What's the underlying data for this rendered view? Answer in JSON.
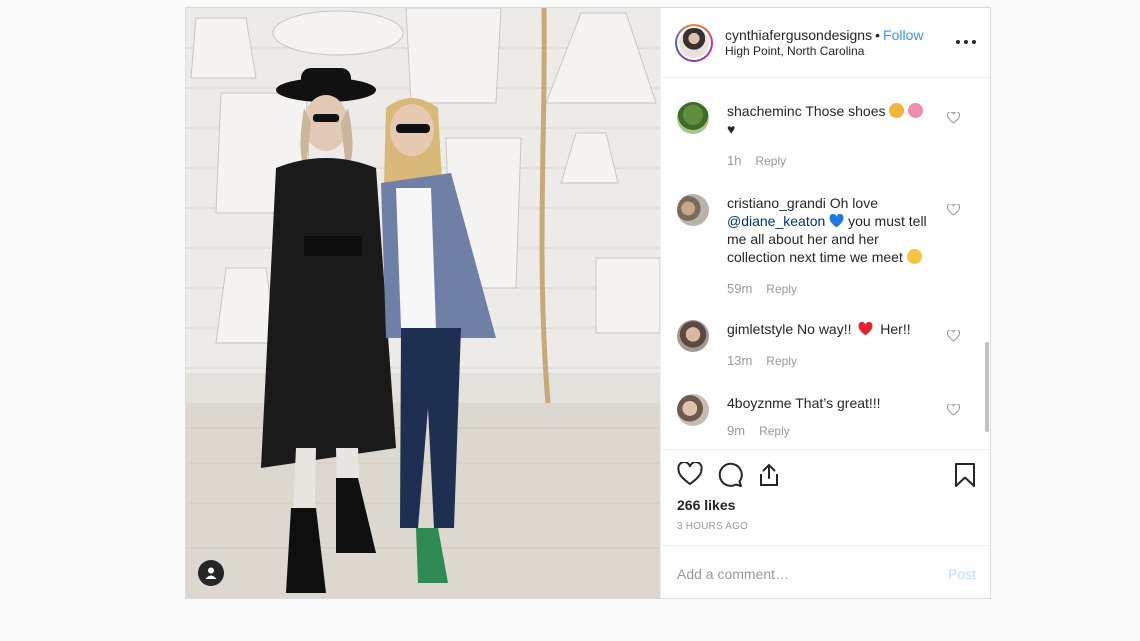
{
  "post": {
    "username": "cynthiafergusondesigns",
    "separator": "•",
    "follow_label": "Follow",
    "location": "High Point, North Carolina"
  },
  "comments": [
    {
      "user": "shacheminc",
      "text_before": "Those shoes",
      "text_after": "",
      "second_line": "♥",
      "time": "1h",
      "reply": "Reply"
    },
    {
      "user": "cristiano_grandi",
      "text_before": "Oh love",
      "mention": "@diane_keaton",
      "text_after": "you must tell me all about her and her collection next time we meet",
      "time": "59m",
      "reply": "Reply"
    },
    {
      "user": "gimletstyle",
      "text_before": "No way!!",
      "text_after": "Her!!",
      "time": "13m",
      "reply": "Reply"
    },
    {
      "user": "4boyznme",
      "text_before": "That’s great!!!",
      "time": "9m",
      "reply": "Reply"
    }
  ],
  "likes": "266 likes",
  "time_ago": "3 HOURS AGO",
  "add_comment_placeholder": "Add a comment…",
  "post_button": "Post",
  "icons": [
    "heart-icon",
    "comment-icon",
    "share-icon",
    "bookmark-icon",
    "more-options-icon",
    "user-tag-icon"
  ],
  "colors": {
    "follow": "#3897f0",
    "mention": "#003569",
    "post_button_disabled": "#b2dffc",
    "muted": "#999999"
  }
}
